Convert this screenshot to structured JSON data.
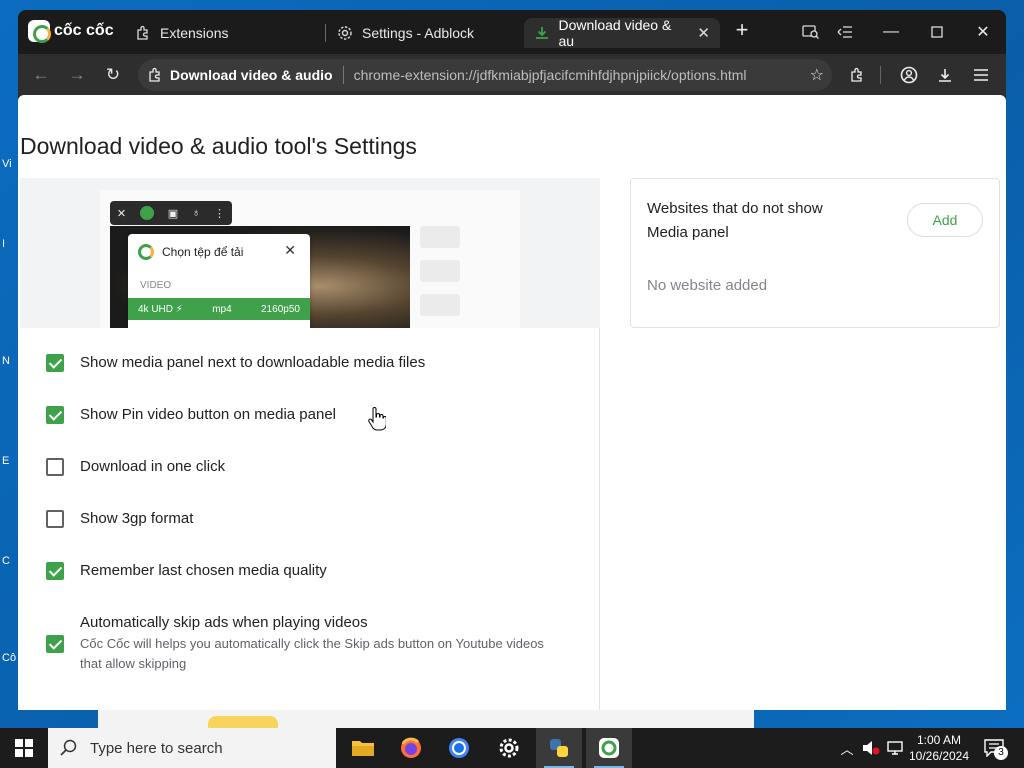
{
  "browser": {
    "brand": "cốc cốc",
    "tabs": [
      {
        "label": "Extensions",
        "icon": "puzzle-icon"
      },
      {
        "label": "Settings - Adblock",
        "icon": "gear-icon"
      },
      {
        "label": "Download video & au",
        "icon": "download-icon",
        "active": true
      }
    ],
    "omnibox": {
      "title": "Download video & audio",
      "url": "chrome-extension://jdfkmiabjpfjacifcmihfdjhpnjpiick/options.html"
    }
  },
  "page": {
    "title": "Download video & audio tool's Settings",
    "preview": {
      "popup_title": "Chọn tệp để tải",
      "section": "VIDEO",
      "row_quality": "4k UHD ⚡",
      "row_format": "mp4",
      "row_res": "2160p50"
    },
    "options": [
      {
        "label": "Show media panel next to downloadable media files",
        "checked": true
      },
      {
        "label": "Show Pin video button on media panel",
        "checked": true
      },
      {
        "label": "Download in one click",
        "checked": false
      },
      {
        "label": "Show 3gp format",
        "checked": false
      },
      {
        "label": "Remember last chosen media quality",
        "checked": true
      },
      {
        "label": "Automatically skip ads when playing videos",
        "checked": true,
        "description": "Cốc Cốc will helps you automatically click the Skip ads button on Youtube videos that allow skipping"
      }
    ],
    "websites_card": {
      "title": "Websites that do not show Media panel",
      "add_label": "Add",
      "empty_text": "No website added"
    }
  },
  "taskbar": {
    "search_placeholder": "Type here to search",
    "time": "1:00 AM",
    "date": "10/26/2024",
    "notification_count": "3"
  },
  "colors": {
    "accent_green": "#3fa24b",
    "taskbar": "#1c1c1c",
    "browser_frame": "#1f1f1f"
  }
}
